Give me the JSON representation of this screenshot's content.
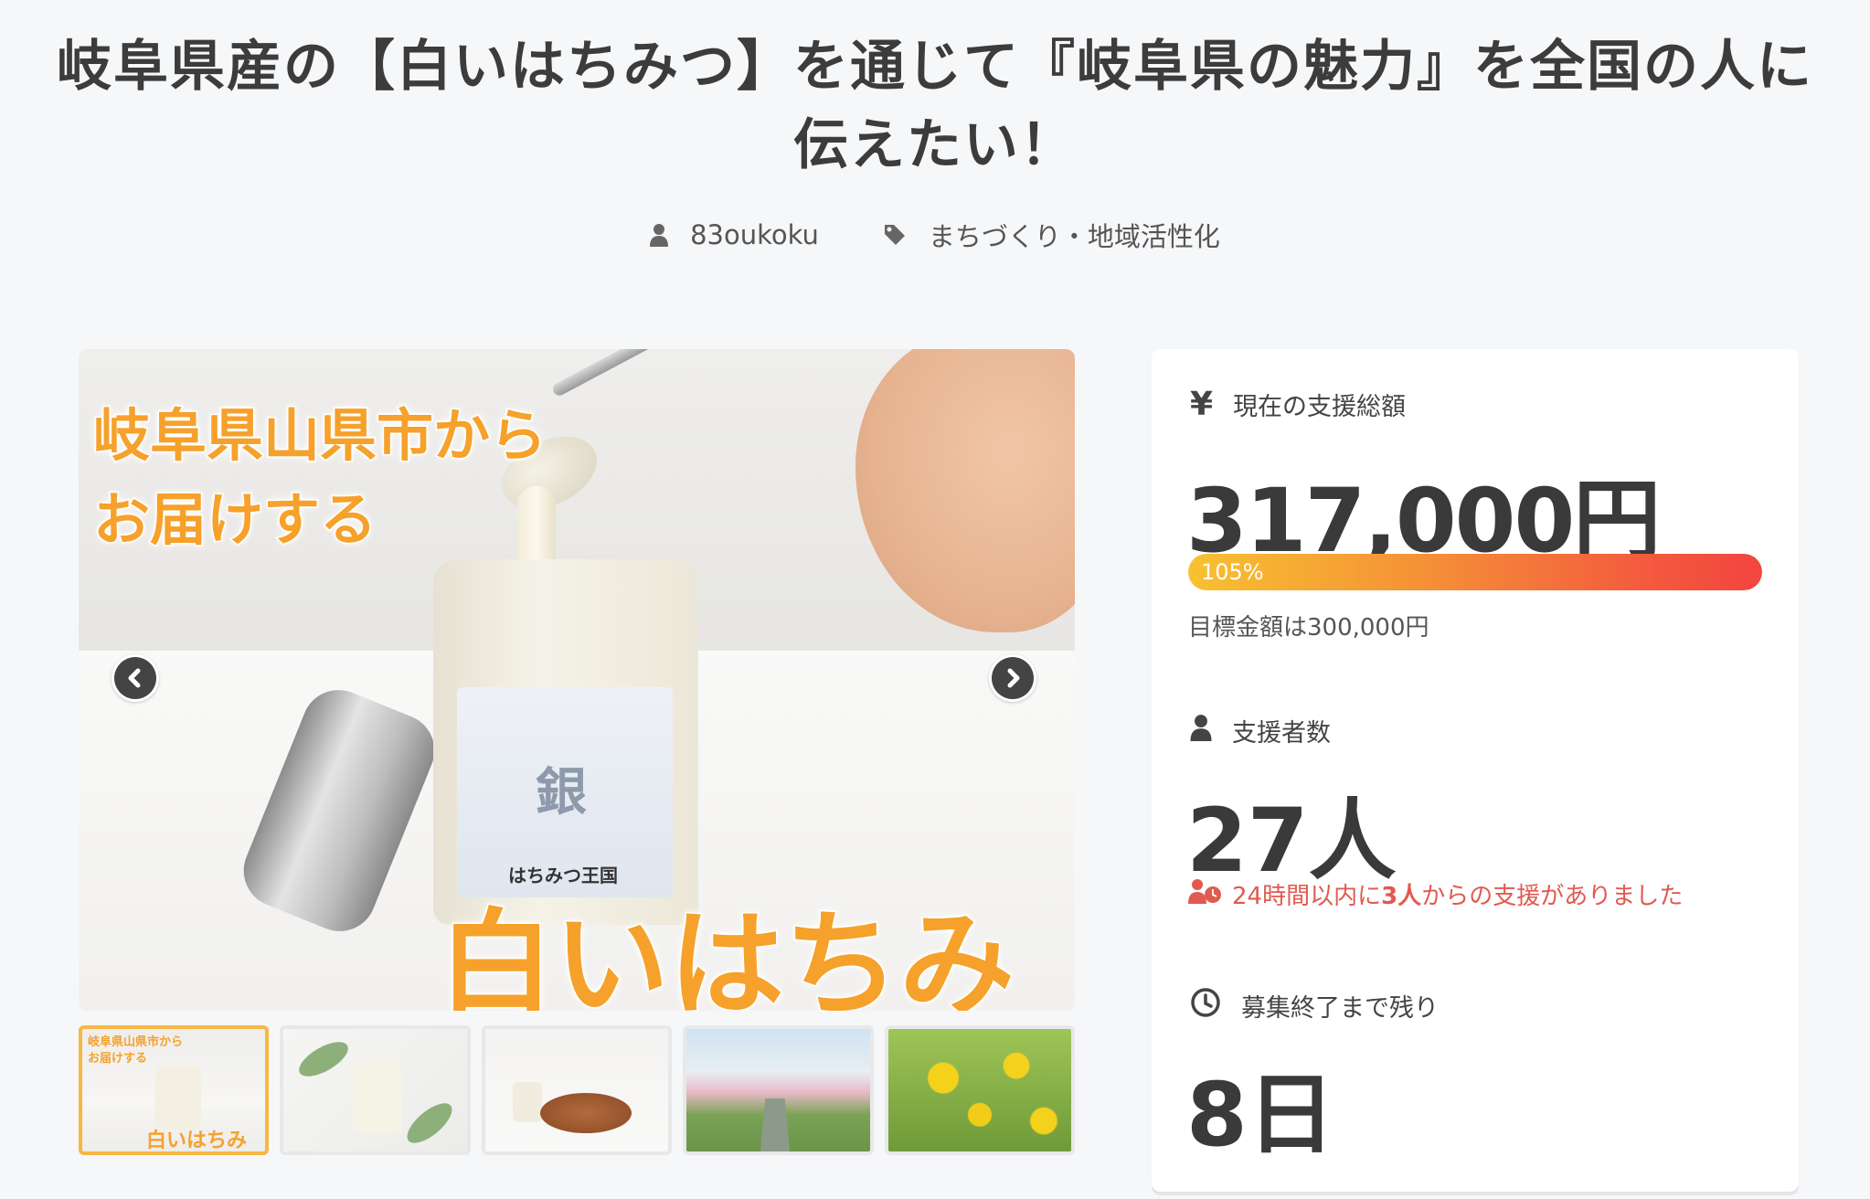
{
  "page": {
    "title": "岐阜県産の【白いはちみつ】を通じて『岐阜県の魅力』を全国の人に伝えたい！"
  },
  "meta": {
    "author": "83oukoku",
    "category": "まちづくり・地域活性化",
    "author_icon": "user-icon",
    "category_icon": "tag-icon"
  },
  "gallery": {
    "hero": {
      "overlay_line1": "岐阜県山県市から",
      "overlay_line2": "お届けする",
      "overlay_big": "白いはちみつ",
      "jar_label_main": "銀",
      "jar_label_brand": "はちみつ王国"
    },
    "prev_icon": "chevron-left-icon",
    "next_icon": "chevron-right-icon",
    "thumbnails": [
      {
        "name": "thumb-1",
        "active": true,
        "mini_line1": "岐阜県山県市から",
        "mini_line2": "お届けする",
        "mini_big": "白いはちみつ"
      },
      {
        "name": "thumb-2",
        "active": false
      },
      {
        "name": "thumb-3",
        "active": false
      },
      {
        "name": "thumb-4",
        "active": false
      },
      {
        "name": "thumb-5",
        "active": false
      }
    ]
  },
  "stats": {
    "total": {
      "icon": "yen-icon",
      "icon_text": "¥",
      "label": "現在の支援総額",
      "value": "317,000円",
      "progress_text": "105%",
      "progress_fraction": 1.05,
      "goal_text": "目標金額は300,000円"
    },
    "backers": {
      "icon": "user-icon",
      "label": "支援者数",
      "value": "27人",
      "recent_prefix": "24時間以内に",
      "recent_count": "3人",
      "recent_suffix": "からの支援がありました"
    },
    "remaining": {
      "icon": "clock-icon",
      "label": "募集終了まで残り",
      "value": "8日"
    }
  },
  "colors": {
    "background": "#f6f7f9",
    "accent_orange": "#f6a12b",
    "progress_start": "#f8c131",
    "progress_end": "#f2453f",
    "recent_red": "#e05a50",
    "active_thumb_border": "#f7b744"
  }
}
